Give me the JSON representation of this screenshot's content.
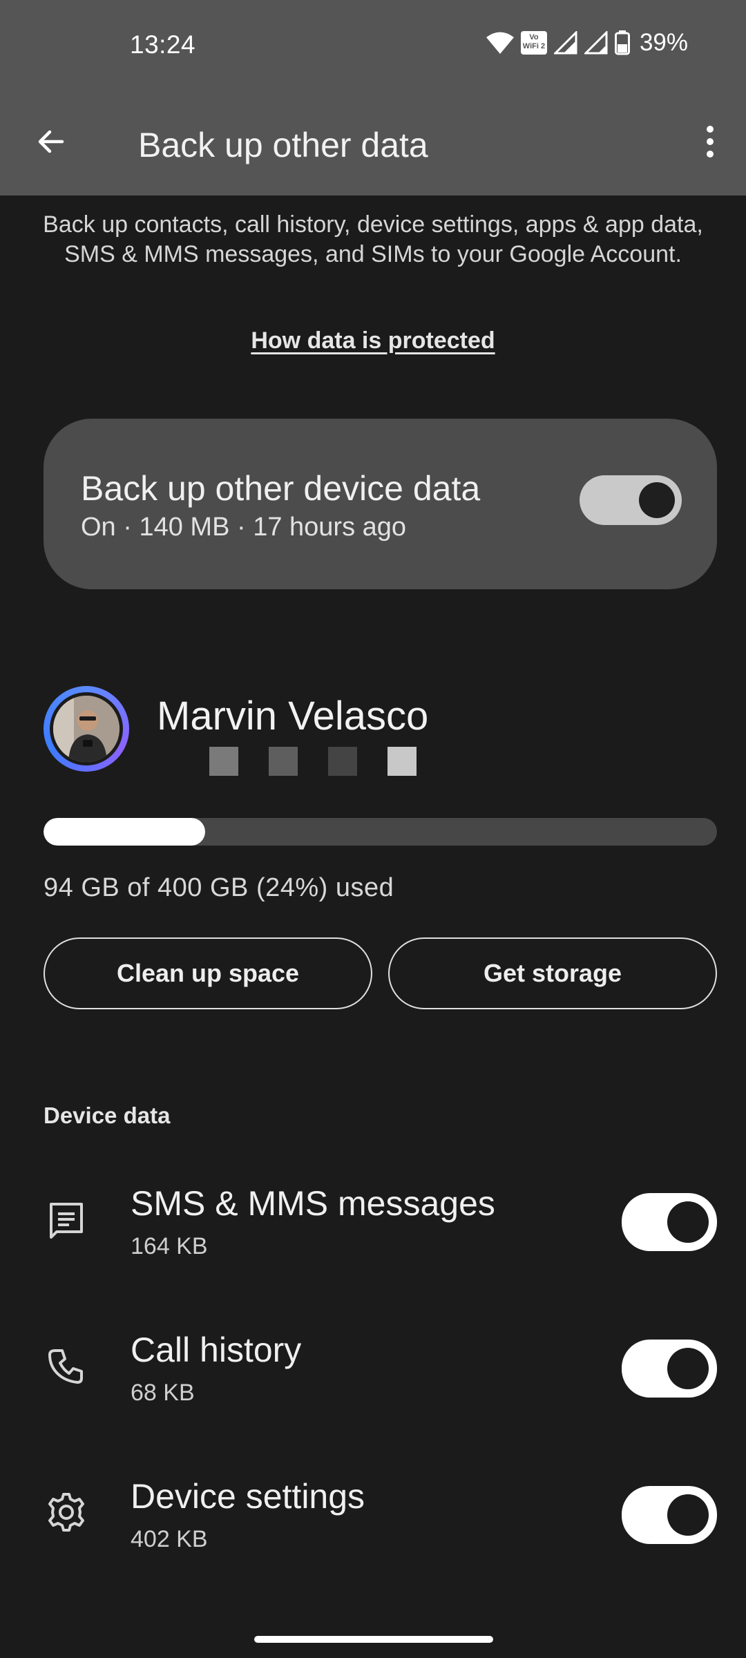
{
  "status_bar": {
    "time": "13:24",
    "battery_percent": "39%",
    "vowifi_label": "Vo WiFi 2",
    "icons": [
      "wifi-icon",
      "vowifi-icon",
      "signal-icon",
      "signal-icon",
      "battery-icon"
    ]
  },
  "app_bar": {
    "title": "Back up other data",
    "back_icon": "arrow-back-icon",
    "more_icon": "more-vert-icon"
  },
  "intro": {
    "description": "Back up contacts, call history, device settings, apps & app data, SMS & MMS messages, and SIMs to your Google Account.",
    "link": "How data is protected"
  },
  "backup_card": {
    "title": "Back up other device data",
    "subtitle": "On · 140 MB · 17 hours ago",
    "toggle_on": true
  },
  "account": {
    "name": "Marvin Velasco",
    "dot_colors": [
      "#7a7a7a",
      "#5e5e5e",
      "#444444",
      "#c8c8c8"
    ]
  },
  "storage": {
    "used_fraction": 0.24,
    "text": "94 GB of 400 GB (24%) used",
    "clean_up_label": "Clean up space",
    "get_storage_label": "Get storage"
  },
  "device_data": {
    "header": "Device data",
    "items": [
      {
        "title": "SMS & MMS messages",
        "size": "164 KB",
        "icon": "message-icon",
        "enabled": true
      },
      {
        "title": "Call history",
        "size": "68 KB",
        "icon": "phone-icon",
        "enabled": true
      },
      {
        "title": "Device settings",
        "size": "402 KB",
        "icon": "gear-icon",
        "enabled": true
      }
    ]
  },
  "colors": {
    "background": "#1b1b1b",
    "app_bar": "#555555",
    "card": "#4c4c4c",
    "accent_ring": "#5a8bff"
  }
}
